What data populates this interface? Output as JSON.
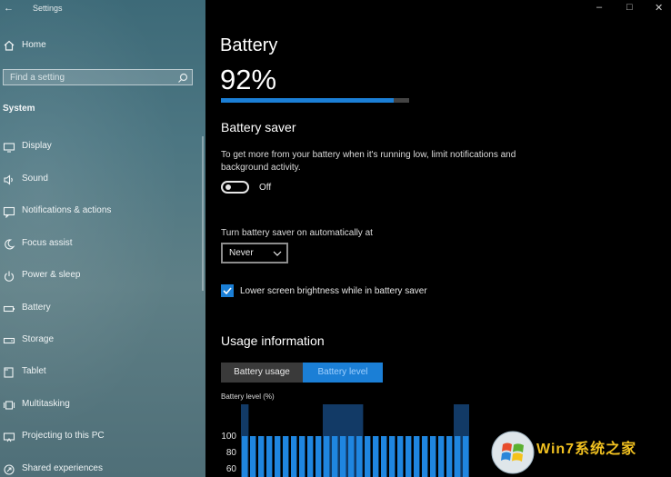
{
  "window": {
    "title": "Settings"
  },
  "sidebar": {
    "home_label": "Home",
    "search_placeholder": "Find a setting",
    "section_title": "System",
    "items": [
      {
        "label": "Display",
        "icon": "display-icon"
      },
      {
        "label": "Sound",
        "icon": "speaker-icon"
      },
      {
        "label": "Notifications & actions",
        "icon": "notification-icon"
      },
      {
        "label": "Focus assist",
        "icon": "moon-icon"
      },
      {
        "label": "Power & sleep",
        "icon": "power-icon"
      },
      {
        "label": "Battery",
        "icon": "battery-icon"
      },
      {
        "label": "Storage",
        "icon": "storage-icon"
      },
      {
        "label": "Tablet",
        "icon": "tablet-icon"
      },
      {
        "label": "Multitasking",
        "icon": "multitasking-icon"
      },
      {
        "label": "Projecting to this PC",
        "icon": "projector-icon"
      },
      {
        "label": "Shared experiences",
        "icon": "share-icon"
      }
    ]
  },
  "main": {
    "title": "Battery",
    "percent_text": "92%",
    "percent_value": 0.92,
    "battery_saver": {
      "heading": "Battery saver",
      "description": "To get more from your battery when it's running low, limit notifications and background activity.",
      "toggle_label": "Off",
      "toggle_on": false,
      "auto_label": "Turn battery saver on automatically at",
      "auto_value": "Never",
      "brightness_label": "Lower screen brightness while in battery saver",
      "brightness_checked": true
    },
    "usage": {
      "heading": "Usage information",
      "tabs": [
        "Battery usage",
        "Battery level"
      ],
      "active_tab": 1
    }
  },
  "chart_data": {
    "type": "bar",
    "title": "Battery level (%)",
    "ytick_labels": [
      "100",
      "80",
      "60"
    ],
    "values": [
      100,
      100,
      100,
      100,
      100,
      100,
      100,
      100,
      100,
      100,
      100,
      100,
      100,
      100,
      100,
      100,
      100,
      100,
      100,
      100,
      100,
      100,
      100,
      100,
      100,
      100,
      100,
      100,
      100,
      100,
      100,
      100
    ],
    "highlight_ranges": [
      [
        0,
        0
      ],
      [
        10,
        14
      ],
      [
        26,
        28
      ]
    ]
  },
  "colors": {
    "accent": "#1b7fd6",
    "sidebar": "#4c7682",
    "background": "#000000"
  },
  "watermark": {
    "text": "Win7系统之家"
  }
}
